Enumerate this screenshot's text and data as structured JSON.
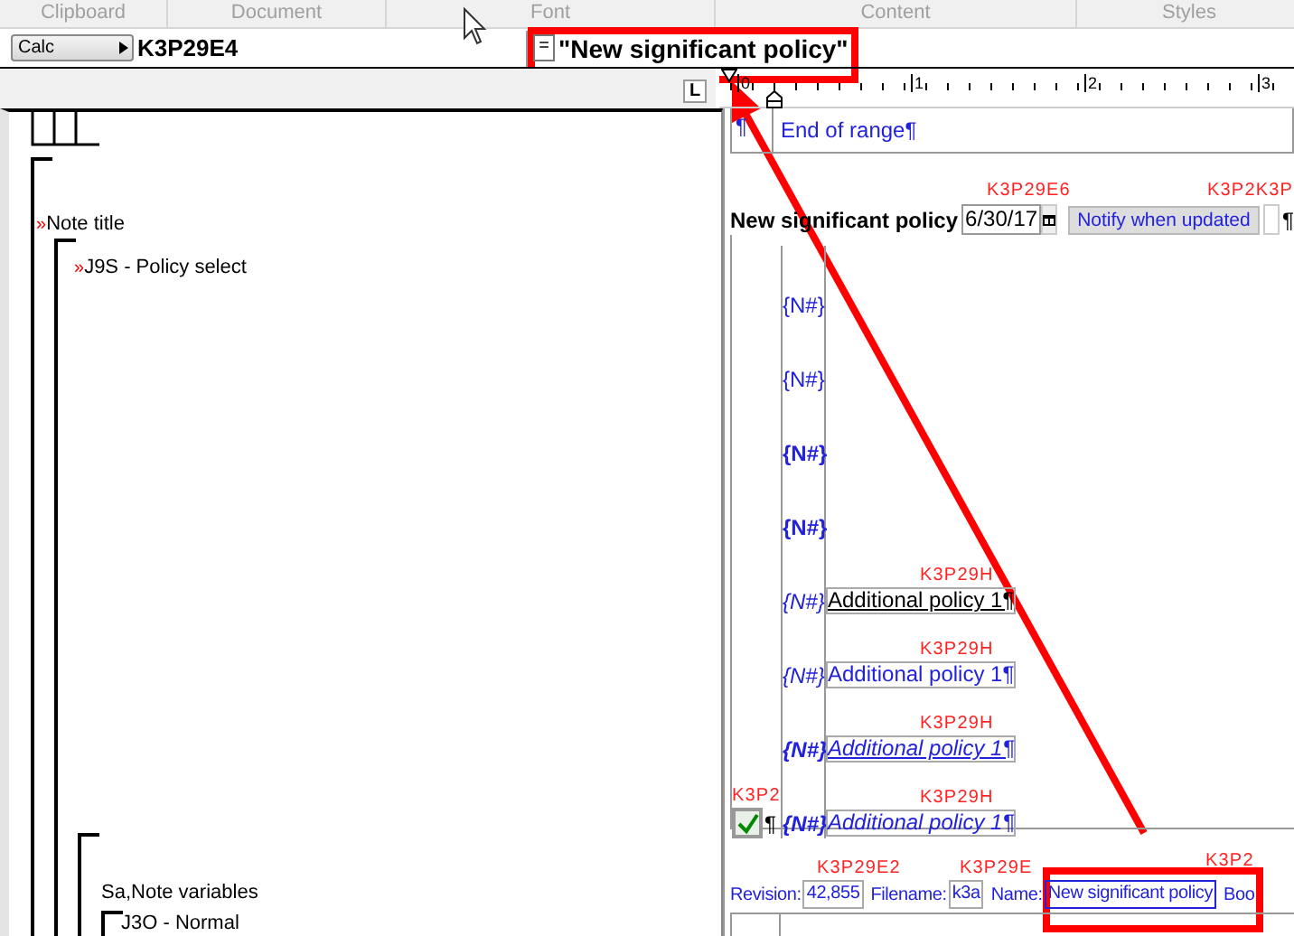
{
  "ribbon_groups": [
    "Clipboard",
    "Document",
    "Font",
    "Content",
    "Styles"
  ],
  "formula_bar": {
    "mode_button": "Calc",
    "cell_ref": "K3P29E4",
    "equals": "=",
    "formula": "\"New significant policy\""
  },
  "ruler": {
    "corner": "L",
    "marks": [
      "0",
      "1",
      "2",
      "3"
    ]
  },
  "tree": [
    {
      "text": "Note title",
      "marker": "»",
      "children": [
        {
          "text": "J9S - Policy select",
          "marker": "»",
          "children": [
            {
              "text": "Sa,Note variables",
              "children": [
                {
                  "text": "J3O - Normal"
                }
              ]
            }
          ]
        }
      ]
    }
  ],
  "document": {
    "end_of_range": {
      "pilcrow": "¶",
      "text": "End of range¶"
    },
    "policy_row": {
      "label": "New significant policy",
      "date_code": "K3P29E6",
      "date": "6/30/17",
      "button_code": "K3P2K3P",
      "button": "Notify when updated",
      "pilcrow": "¶"
    },
    "rows": [
      {
        "tag": "{N#}",
        "bold": false,
        "italic": false
      },
      {
        "tag": "{N#}",
        "bold": false,
        "italic": false
      },
      {
        "tag": "{N#}",
        "bold": true,
        "italic": false
      },
      {
        "tag": "{N#}",
        "bold": true,
        "italic": false
      },
      {
        "tag": "{N#}",
        "bold": false,
        "italic": true,
        "entry": {
          "code": "K3P29H",
          "text": "Additional policy 1¶",
          "kind": "plain",
          "italic": false,
          "underlined": true
        }
      },
      {
        "tag": "{N#}",
        "bold": false,
        "italic": true,
        "entry": {
          "code": "K3P29H",
          "text": "Additional policy 1¶",
          "kind": "field",
          "italic": false,
          "underlined": false
        }
      },
      {
        "tag": "{N#}",
        "bold": true,
        "italic": true,
        "entry": {
          "code": "K3P29H",
          "text": "Additional policy 1¶",
          "kind": "field",
          "italic": true,
          "underlined": true
        }
      },
      {
        "tag": "{N#}",
        "bold": true,
        "italic": true,
        "entry": {
          "code": "K3P29H",
          "text": "Additional policy 1¶",
          "kind": "field",
          "italic": true,
          "underlined": false
        },
        "checkbox": {
          "code": "K3P2",
          "checked": true,
          "pilcrow": "¶"
        }
      }
    ],
    "footer": [
      {
        "label": "Revision:",
        "code": "K3P29E2",
        "value": "42,855"
      },
      {
        "label": "Filename:",
        "code": "K3P29E",
        "value": "k3a"
      },
      {
        "label": "Name:",
        "code": "K3P2",
        "value": "New significant policy"
      }
    ],
    "footer_trailing": "Boo"
  }
}
